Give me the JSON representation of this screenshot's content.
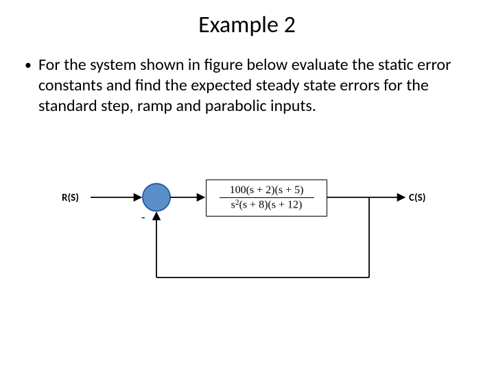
{
  "title": "Example 2",
  "bullet": {
    "text": "For the system shown in figure below evaluate the static error constants and find the expected steady state errors for the standard step, ramp and parabolic inputs."
  },
  "diagram": {
    "input_label": "R(S)",
    "output_label": "C(S)",
    "minus_sign": "-",
    "tf_numerator": "100(s + 2)(s + 5)",
    "tf_denominator_html": "s²(s + 8)(s + 12)"
  }
}
